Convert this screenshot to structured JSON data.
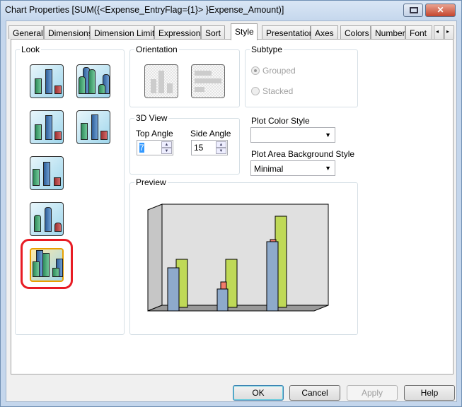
{
  "window": {
    "title": "Chart Properties [SUM({<Expense_EntryFlag={1}> }Expense_Amount)]"
  },
  "tabs": [
    {
      "label": "General"
    },
    {
      "label": "Dimensions"
    },
    {
      "label": "Dimension Limits"
    },
    {
      "label": "Expressions"
    },
    {
      "label": "Sort"
    },
    {
      "label": "Style",
      "active": true
    },
    {
      "label": "Presentation"
    },
    {
      "label": "Axes"
    },
    {
      "label": "Colors"
    },
    {
      "label": "Number"
    },
    {
      "label": "Font"
    }
  ],
  "look": {
    "label": "Look",
    "selected_index": 6
  },
  "orientation": {
    "label": "Orientation"
  },
  "subtype": {
    "label": "Subtype",
    "options": [
      {
        "label": "Grouped",
        "checked": true,
        "enabled": false
      },
      {
        "label": "Stacked",
        "checked": false,
        "enabled": false
      }
    ]
  },
  "view3d": {
    "label": "3D View",
    "top_angle_label": "Top Angle",
    "top_angle": "7",
    "side_angle_label": "Side Angle",
    "side_angle": "15"
  },
  "plot_color_style": {
    "label": "Plot Color Style",
    "value": ""
  },
  "plot_bg_style": {
    "label": "Plot Area Background Style",
    "value": "Minimal"
  },
  "preview": {
    "label": "Preview"
  },
  "buttons": {
    "ok": "OK",
    "cancel": "Cancel",
    "apply": "Apply",
    "help": "Help"
  },
  "colors": {
    "highlight": "#e81c24",
    "series": [
      "#8eaacb",
      "#f27c6b",
      "#bfd957"
    ]
  }
}
